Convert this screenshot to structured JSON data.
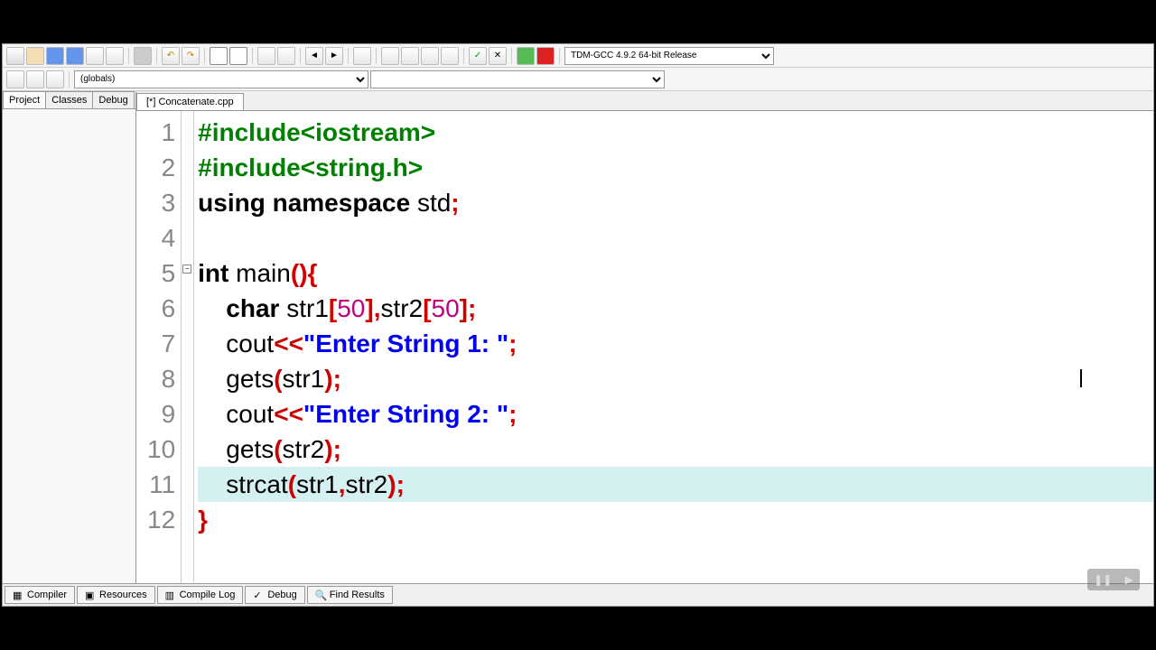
{
  "toolbar": {
    "compiler_select": "TDM-GCC 4.9.2 64-bit Release",
    "scope_select": "(globals)"
  },
  "side_tabs": [
    "Project",
    "Classes",
    "Debug"
  ],
  "file_tab": "[*] Concatenate.cpp",
  "code": {
    "lines": [
      {
        "n": "1"
      },
      {
        "n": "2"
      },
      {
        "n": "3"
      },
      {
        "n": "4"
      },
      {
        "n": "5"
      },
      {
        "n": "6"
      },
      {
        "n": "7"
      },
      {
        "n": "8"
      },
      {
        "n": "9"
      },
      {
        "n": "10"
      },
      {
        "n": "11"
      },
      {
        "n": "12"
      }
    ],
    "highlighted_line": 11,
    "fold_marker_line": 5,
    "tokens": {
      "l1_pre": "#include<iostream>",
      "l2_pre": "#include<string.h>",
      "l3_kw1": "using",
      "l3_kw2": "namespace",
      "l3_id": "std",
      "l3_sc": ";",
      "l5_kw1": "int",
      "l5_id": "main",
      "l5_p1": "(",
      "l5_p2": ")",
      "l5_br": "{",
      "l6_kw": "char",
      "l6_id1": "str1",
      "l6_b1": "[",
      "l6_n1": "50",
      "l6_b2": "]",
      "l6_c": ",",
      "l6_id2": "str2",
      "l6_b3": "[",
      "l6_n2": "50",
      "l6_b4": "]",
      "l6_sc": ";",
      "l7_id": "cout",
      "l7_op": "<<",
      "l7_str": "\"Enter String 1: \"",
      "l7_sc": ";",
      "l8_id": "gets",
      "l8_p1": "(",
      "l8_a": "str1",
      "l8_p2": ")",
      "l8_sc": ";",
      "l9_id": "cout",
      "l9_op": "<<",
      "l9_str": "\"Enter String 2: \"",
      "l9_sc": ";",
      "l10_id": "gets",
      "l10_p1": "(",
      "l10_a": "str2",
      "l10_p2": ")",
      "l10_sc": ";",
      "l11_id": "strcat",
      "l11_p1": "(",
      "l11_a1": "str1",
      "l11_c": ",",
      "l11_a2": "str2",
      "l11_p2": ")",
      "l11_sc": ";",
      "l12_br": "}"
    }
  },
  "bottom_tabs": {
    "compiler": "Compiler",
    "resources": "Resources",
    "compile_log": "Compile Log",
    "debug": "Debug",
    "find_results": "Find Results"
  }
}
